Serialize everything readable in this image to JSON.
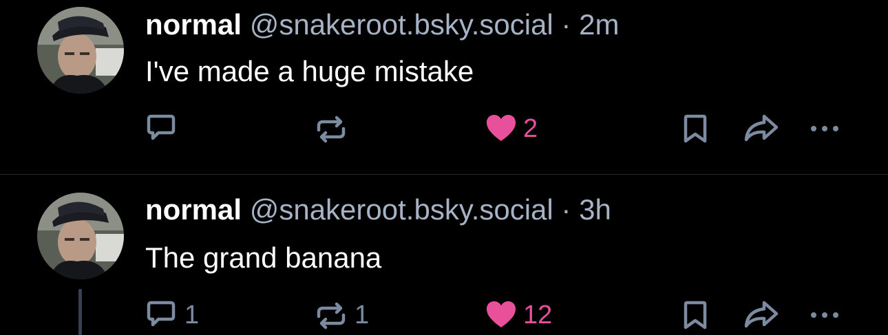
{
  "colors": {
    "background": "#000000",
    "text": "#ffffff",
    "muted": "#a7b2c4",
    "icon": "#7c8ba0",
    "like": "#e8509b",
    "divider": "#232a33"
  },
  "posts": [
    {
      "display_name": "normal",
      "handle": "@snakeroot.bsky.social",
      "separator": "·",
      "time": "2m",
      "text": "I've made a huge mistake",
      "reply_count": "",
      "repost_count": "",
      "like_count": "2",
      "liked": true
    },
    {
      "display_name": "normal",
      "handle": "@snakeroot.bsky.social",
      "separator": "·",
      "time": "3h",
      "text": "The grand banana",
      "reply_count": "1",
      "repost_count": "1",
      "like_count": "12",
      "liked": true
    }
  ],
  "icons": {
    "reply": "speech-bubble-icon",
    "repost": "repost-arrows-icon",
    "like": "heart-icon",
    "bookmark": "bookmark-icon",
    "share": "share-arrow-icon",
    "more": "more-dots-icon"
  }
}
